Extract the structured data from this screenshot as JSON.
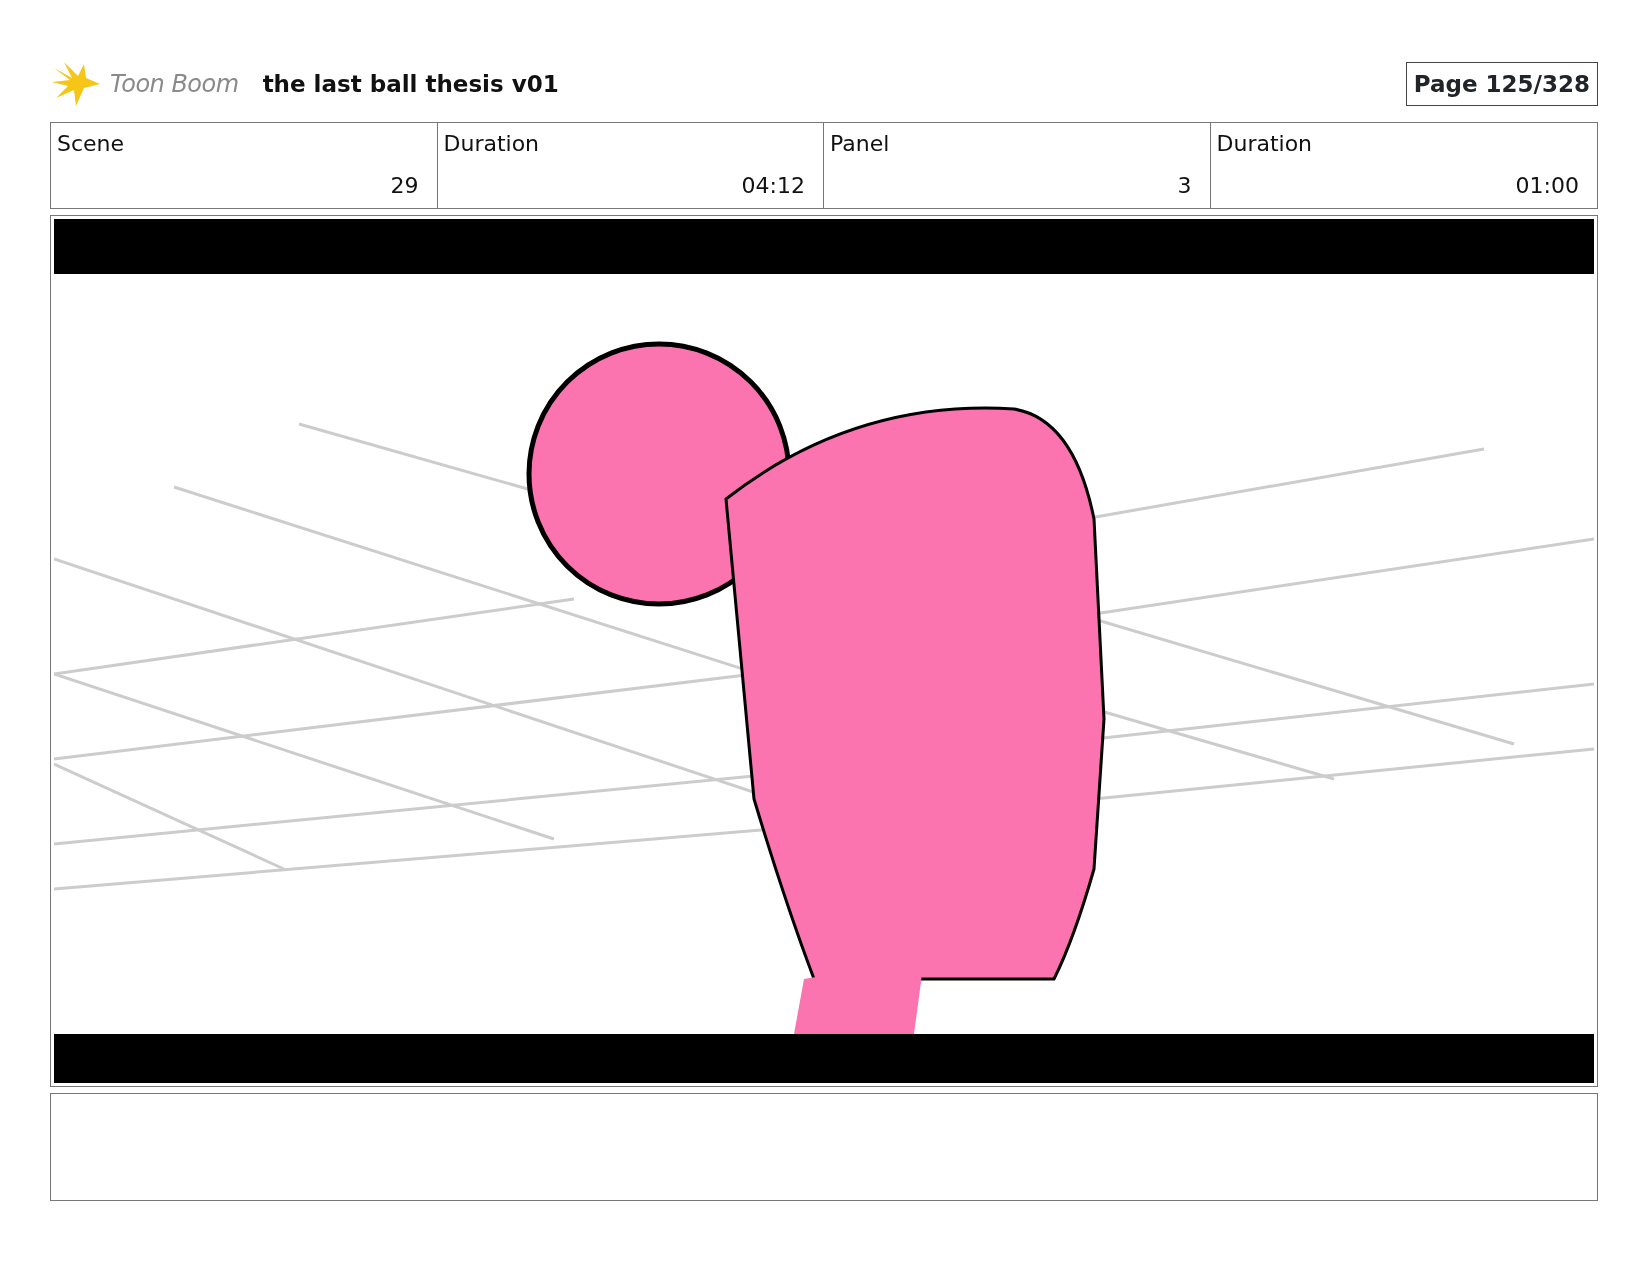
{
  "header": {
    "logo_text": "Toon Boom",
    "title": "the last ball thesis v01",
    "page": "Page 125/328"
  },
  "info": [
    {
      "label": "Scene",
      "value": "29"
    },
    {
      "label": "Duration",
      "value": "04:12"
    },
    {
      "label": "Panel",
      "value": "3"
    },
    {
      "label": "Duration",
      "value": "01:00"
    }
  ]
}
